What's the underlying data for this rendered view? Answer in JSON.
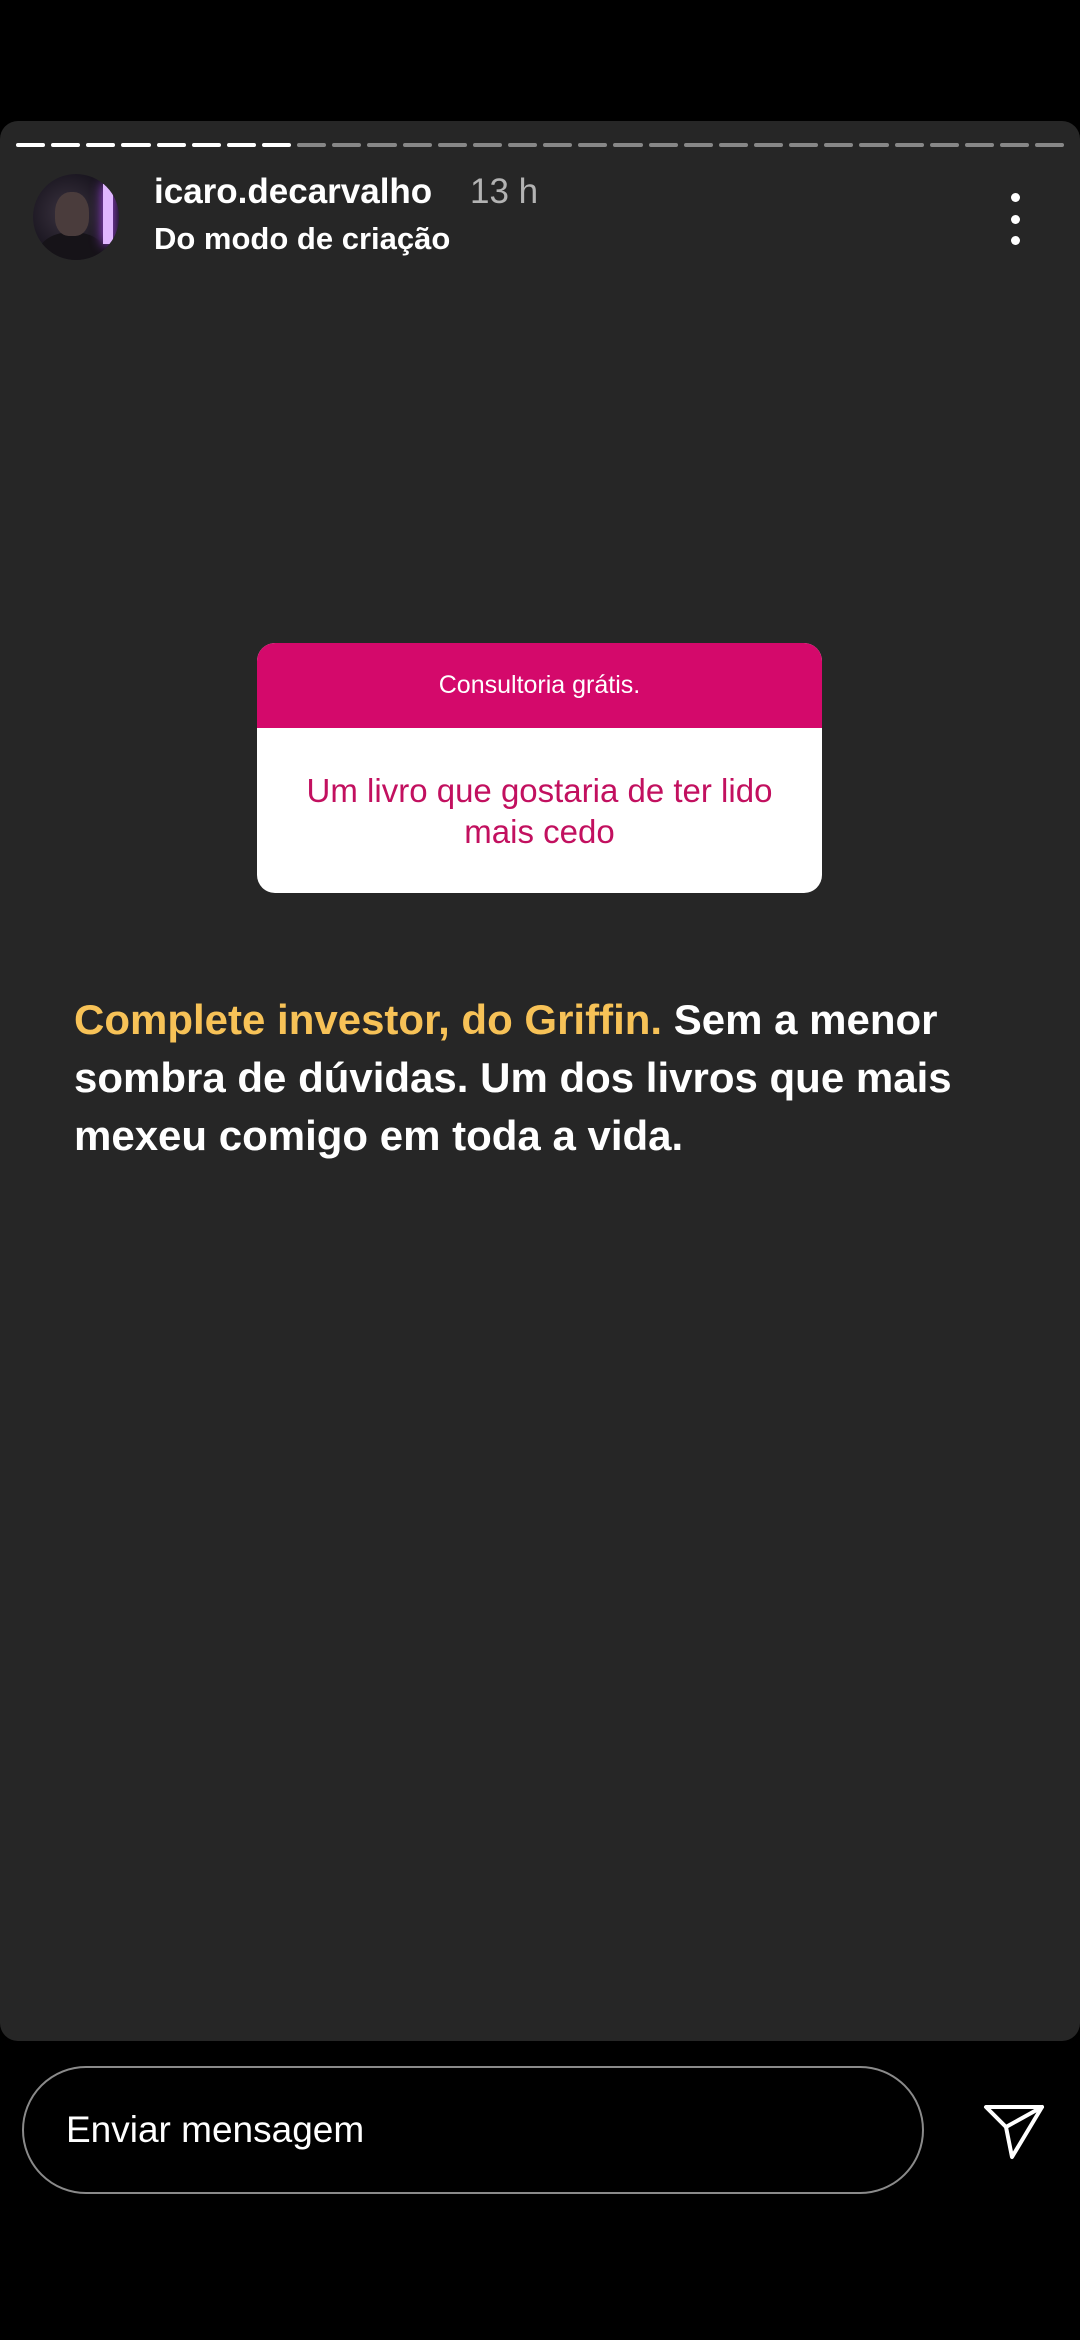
{
  "story": {
    "progress": {
      "total_segments": 30,
      "completed_segments": 8
    },
    "author": {
      "username": "icaro.decarvalho",
      "time_ago": "13 h",
      "subtitle": "Do modo de criação"
    },
    "more_icon": "more-vertical-icon",
    "question_sticker": {
      "header": "Consultoria grátis.",
      "question": "Um livro que gostaria de ter lido mais cedo"
    },
    "answer": {
      "highlight": "Complete investor, do Griffin.",
      "text": " Sem a menor sombra de dúvidas. Um dos livros que mais mexeu comigo em toda a vida."
    }
  },
  "reply": {
    "placeholder": "Enviar mensagem",
    "send_icon": "send-icon"
  },
  "colors": {
    "story_bg": "#262626",
    "sticker_header": "#d4096b",
    "sticker_question": "#c2105f",
    "answer_highlight": "#f7c257"
  }
}
